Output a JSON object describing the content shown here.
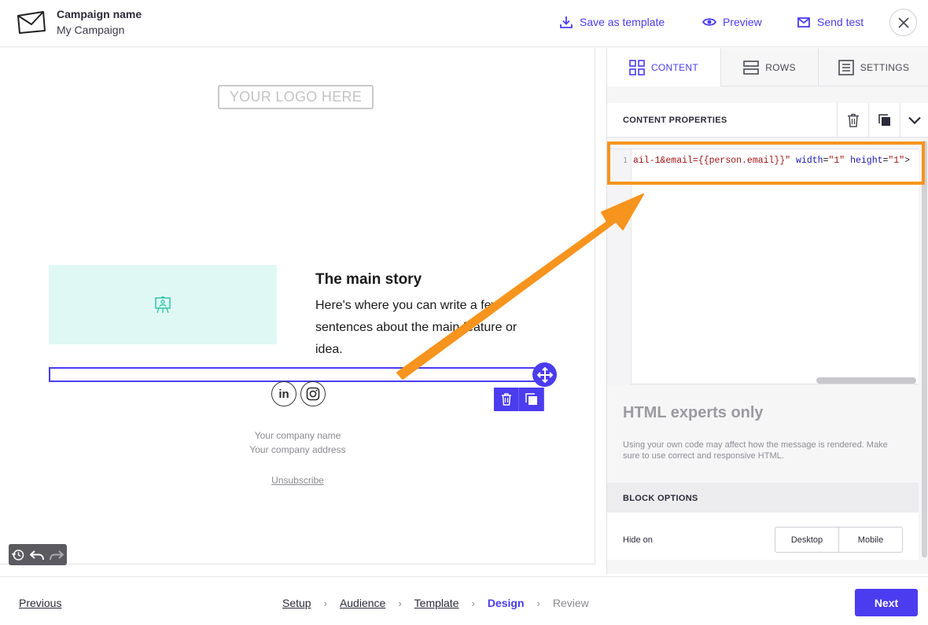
{
  "header": {
    "campaign_label": "Campaign name",
    "campaign_value": "My Campaign",
    "save_template": "Save as template",
    "preview": "Preview",
    "send_test": "Send test"
  },
  "canvas": {
    "logo_placeholder": "YOUR LOGO HERE",
    "story_title": "The main story",
    "story_body": "Here's where you can write a few sentences about the main feature or idea.",
    "social_linkedin": "in",
    "company_name": "Your company name",
    "company_address": "Your company address",
    "unsubscribe": "Unsubscribe"
  },
  "panel": {
    "tabs": [
      {
        "label": "CONTENT",
        "icon": "grid-icon",
        "active": true
      },
      {
        "label": "ROWS",
        "icon": "rows-icon",
        "active": false
      },
      {
        "label": "SETTINGS",
        "icon": "settings-icon",
        "active": false
      }
    ],
    "content_properties": "CONTENT PROPERTIES",
    "editor": {
      "line_number": "1",
      "code_parts": [
        {
          "text": "ail-1&email={{person.email}}\"",
          "type": "str"
        },
        {
          "text": " width",
          "type": "attr"
        },
        {
          "text": "=",
          "type": "pun"
        },
        {
          "text": "\"1\"",
          "type": "str"
        },
        {
          "text": " height",
          "type": "attr"
        },
        {
          "text": "=",
          "type": "pun"
        },
        {
          "text": "\"1\"",
          "type": "str"
        },
        {
          "text": ">",
          "type": "pun"
        }
      ]
    },
    "experts_title": "HTML experts only",
    "experts_note": "Using your own code may affect how the message is rendered. Make sure to use correct and responsive HTML.",
    "block_options": "BLOCK OPTIONS",
    "hide_on": "Hide on",
    "desktop": "Desktop",
    "mobile": "Mobile"
  },
  "footer": {
    "previous": "Previous",
    "steps": [
      "Setup",
      "Audience",
      "Template",
      "Design",
      "Review"
    ],
    "current_step": "Design",
    "next": "Next"
  },
  "colors": {
    "accent": "#4b3cf0",
    "highlight": "#f7941d",
    "image_placeholder": "#dff8f4"
  }
}
